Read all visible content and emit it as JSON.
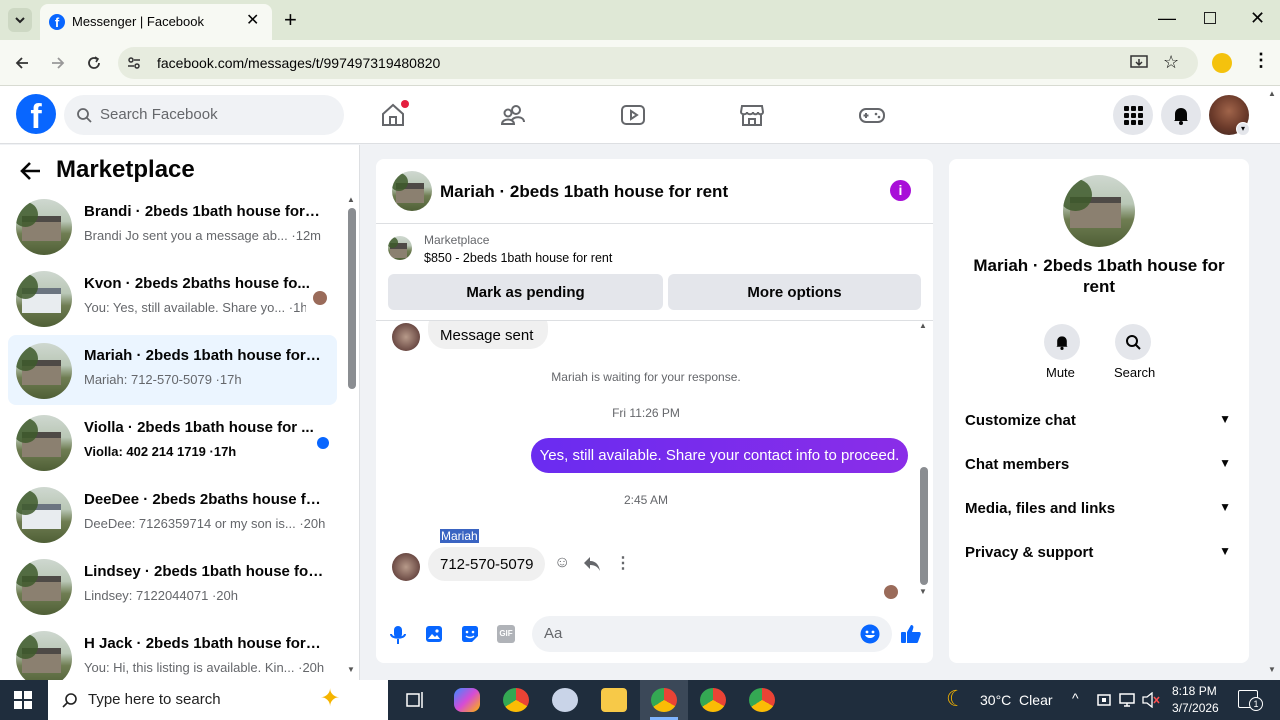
{
  "browser": {
    "tab_title": "Messenger | Facebook",
    "url": "facebook.com/messages/t/997497319480820"
  },
  "topbar": {
    "search_placeholder": "Search Facebook"
  },
  "left_panel": {
    "title": "Marketplace",
    "conversations": [
      {
        "name": "Brandi · 2beds 1bath house for r...",
        "snippet": "Brandi Jo sent you a message ab... ·12m",
        "bold": false
      },
      {
        "name": "Kvon · 2beds 2baths house fo...",
        "snippet": "You: Yes, still available. Share yo... ·1h",
        "bold": false
      },
      {
        "name": "Mariah · 2beds 1bath house for r...",
        "snippet": "Mariah: 712-570-5079 ·17h",
        "bold": false
      },
      {
        "name": "Violla · 2beds 1bath house for ...",
        "snippet": "Violla: 402 214 1719 ·17h",
        "bold": true
      },
      {
        "name": "DeeDee · 2beds 2baths house fo...",
        "snippet": "DeeDee: 7126359714 or my son is... ·20h",
        "bold": false
      },
      {
        "name": "Lindsey · 2beds 1bath house for ...",
        "snippet": "Lindsey: 7122044071 ·20h",
        "bold": false
      },
      {
        "name": "H Jack · 2beds 1bath house for r...",
        "snippet": "You: Hi, this listing is available. Kin... ·20h",
        "bold": false
      }
    ]
  },
  "chat": {
    "title": "Mariah · 2beds 1bath house for rent",
    "listing_source": "Marketplace",
    "listing_title": "$850 - 2beds 1bath house for rent",
    "mark_pending": "Mark as pending",
    "more_options": "More options",
    "msg_sent": "Message sent",
    "waiting_note": "Mariah is waiting for your response.",
    "time1": "Fri 11:26 PM",
    "outgoing": "Yes, still available. Share your contact info to proceed.",
    "time2": "2:45 AM",
    "sender_name": "Mariah",
    "incoming": "712-570-5079",
    "composer_placeholder": "Aa"
  },
  "right_panel": {
    "name": "Mariah · 2beds 1bath house for rent",
    "mute": "Mute",
    "search": "Search",
    "sections": [
      "Customize chat",
      "Chat members",
      "Media, files and links",
      "Privacy & support"
    ]
  },
  "taskbar": {
    "search_placeholder": "Type here to search",
    "weather": "30°C  Clear",
    "time": "8:18 PM",
    "date": "3/7/2026",
    "notification_count": "1"
  },
  "colors": {
    "fb_blue": "#0866ff",
    "messenger_purple": "#7b2ff2",
    "unread_dot": "#0866ff"
  }
}
